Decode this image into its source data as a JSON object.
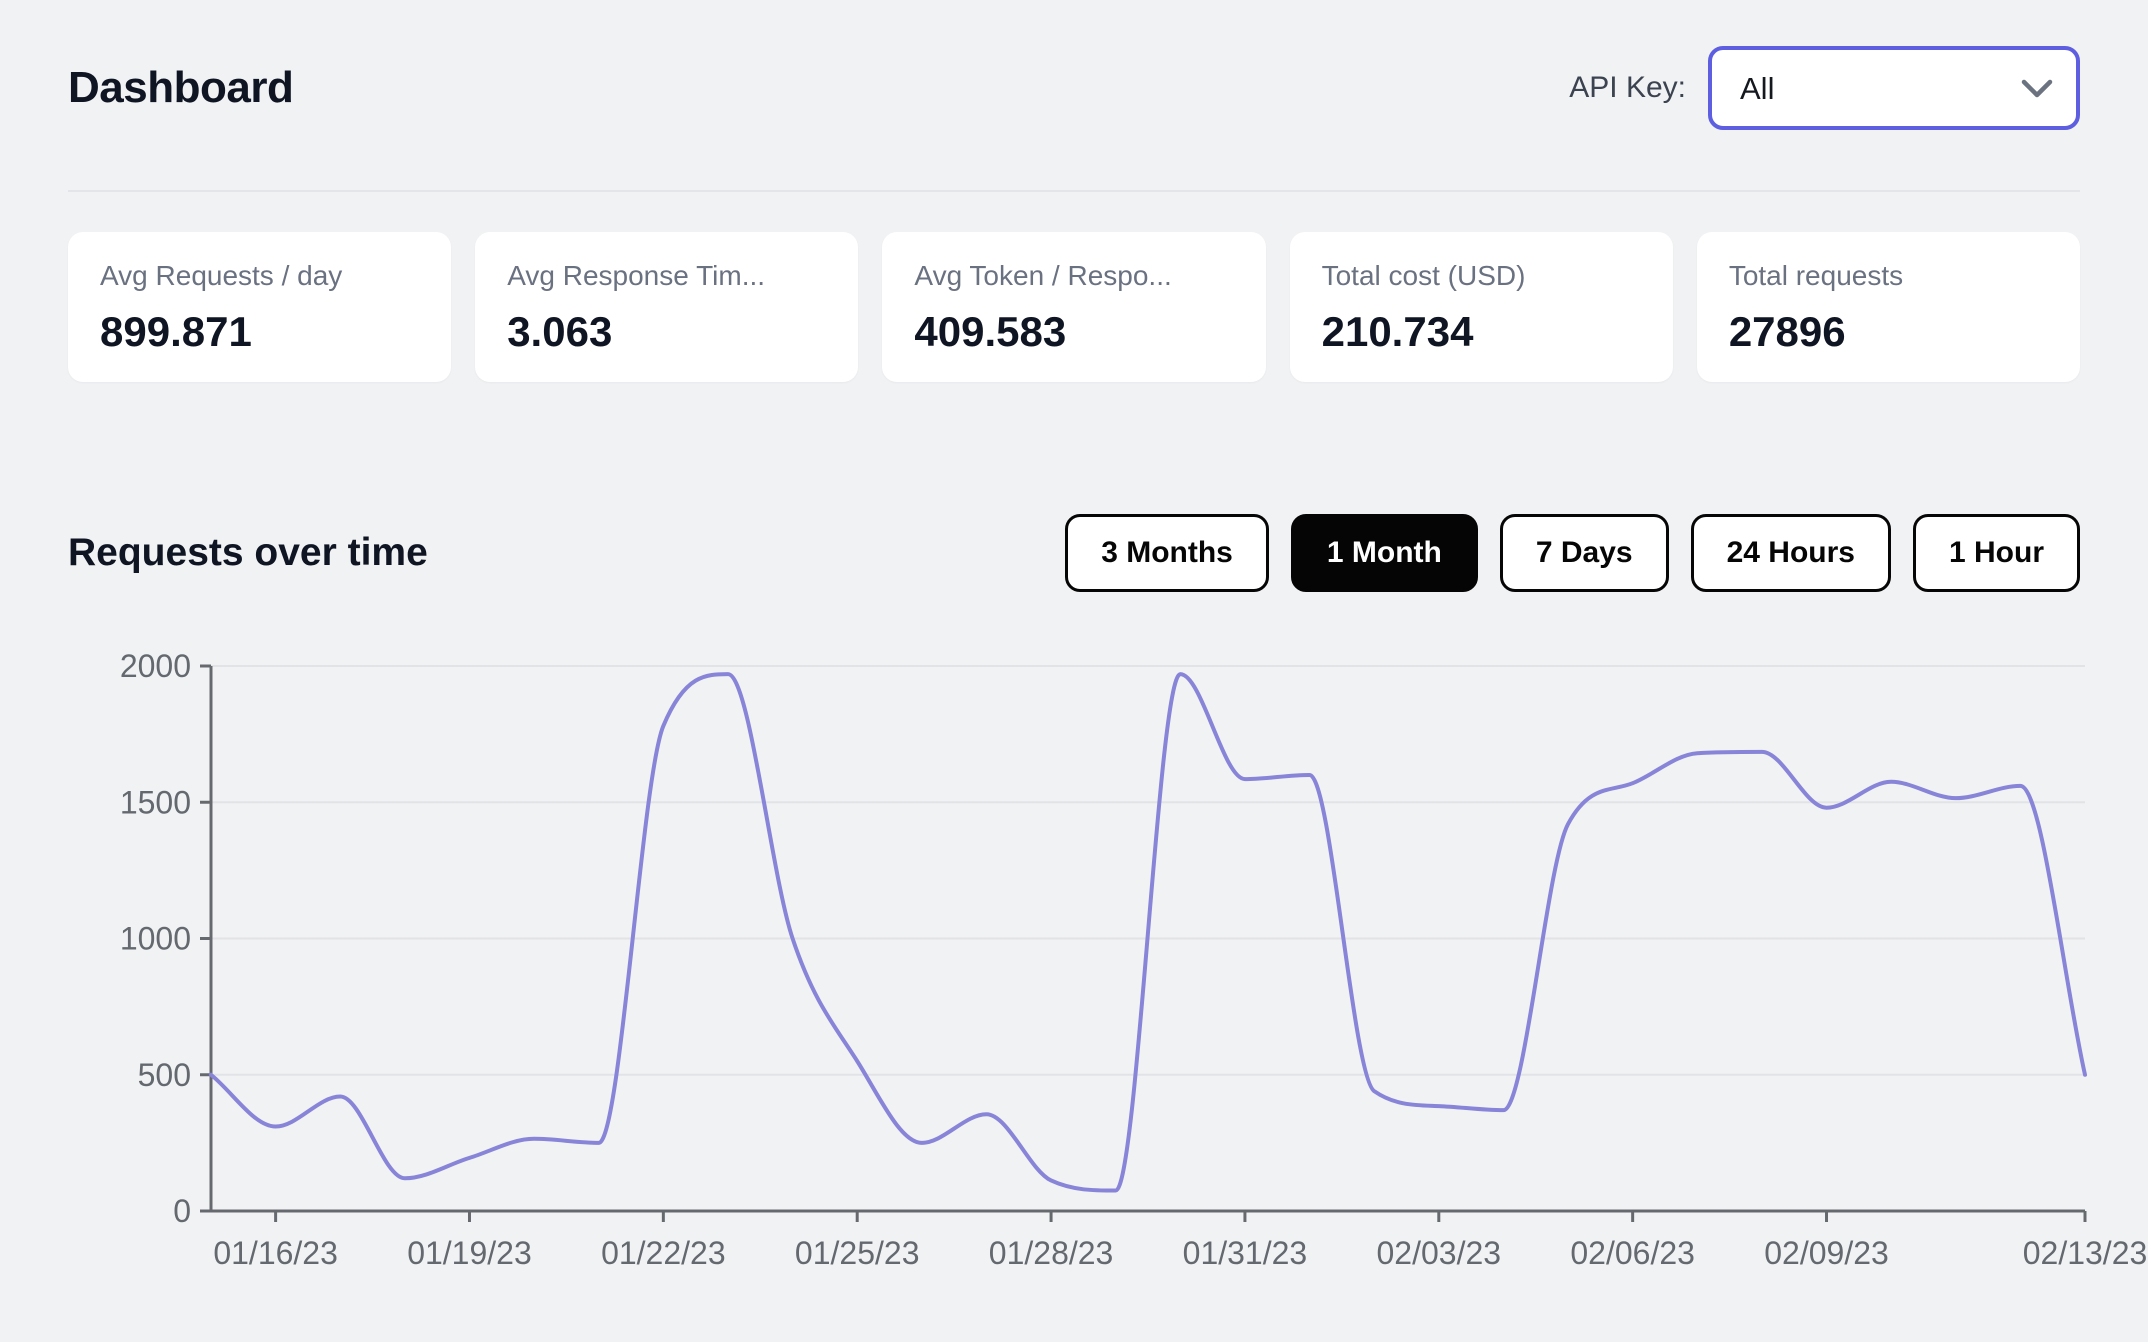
{
  "header": {
    "title": "Dashboard",
    "api_key_label": "API Key:",
    "api_key_value": "All"
  },
  "cards": [
    {
      "label": "Avg Requests / day",
      "value": "899.871"
    },
    {
      "label": "Avg Response Tim...",
      "value": "3.063"
    },
    {
      "label": "Avg Token / Respo...",
      "value": "409.583"
    },
    {
      "label": "Total cost (USD)",
      "value": "210.734"
    },
    {
      "label": "Total requests",
      "value": "27896"
    }
  ],
  "section": {
    "title": "Requests over time",
    "range_buttons": [
      {
        "label": "3 Months",
        "active": false
      },
      {
        "label": "1 Month",
        "active": true
      },
      {
        "label": "7 Days",
        "active": false
      },
      {
        "label": "24 Hours",
        "active": false
      },
      {
        "label": "1 Hour",
        "active": false
      }
    ]
  },
  "icons": {
    "select_chevron": "chevron-down-icon"
  },
  "colors": {
    "accent_indigo": "#5d5fe0",
    "line_purple": "#8884d8",
    "axis_gray": "#666a6f",
    "grid_gray": "#e2e3e6",
    "tick_text": "#64696f",
    "active_button_bg": "#050505",
    "page_bg": "#f1f2f4"
  },
  "chart_data": {
    "type": "line",
    "title": "Requests over time",
    "x": [
      "01/15/23",
      "01/16/23",
      "01/17/23",
      "01/18/23",
      "01/19/23",
      "01/20/23",
      "01/21/23",
      "01/22/23",
      "01/23/23",
      "01/24/23",
      "01/25/23",
      "01/26/23",
      "01/27/23",
      "01/28/23",
      "01/29/23",
      "01/30/23",
      "01/31/23",
      "02/01/23",
      "02/02/23",
      "02/03/23",
      "02/04/23",
      "02/05/23",
      "02/06/23",
      "02/07/23",
      "02/08/23",
      "02/09/23",
      "02/10/23",
      "02/11/23",
      "02/12/23",
      "02/13/23"
    ],
    "series": [
      {
        "name": "requests",
        "values": [
          500,
          310,
          420,
          120,
          195,
          265,
          250,
          1780,
          1970,
          1000,
          550,
          250,
          355,
          112,
          75,
          1970,
          1585,
          1600,
          440,
          385,
          370,
          1420,
          1570,
          1680,
          1685,
          1480,
          1575,
          1515,
          1560,
          500
        ]
      }
    ],
    "x_tick_labels": [
      "01/16/23",
      "01/19/23",
      "01/22/23",
      "01/25/23",
      "01/28/23",
      "01/31/23",
      "02/03/23",
      "02/06/23",
      "02/09/23",
      "02/13/23"
    ],
    "x_tick_indices": [
      1,
      4,
      7,
      10,
      13,
      16,
      19,
      22,
      25,
      29
    ],
    "y_ticks": [
      0,
      500,
      1000,
      1500,
      2000
    ],
    "ylim": [
      0,
      2000
    ],
    "grid": "horizontal",
    "legend": "none",
    "curve": "monotone"
  }
}
